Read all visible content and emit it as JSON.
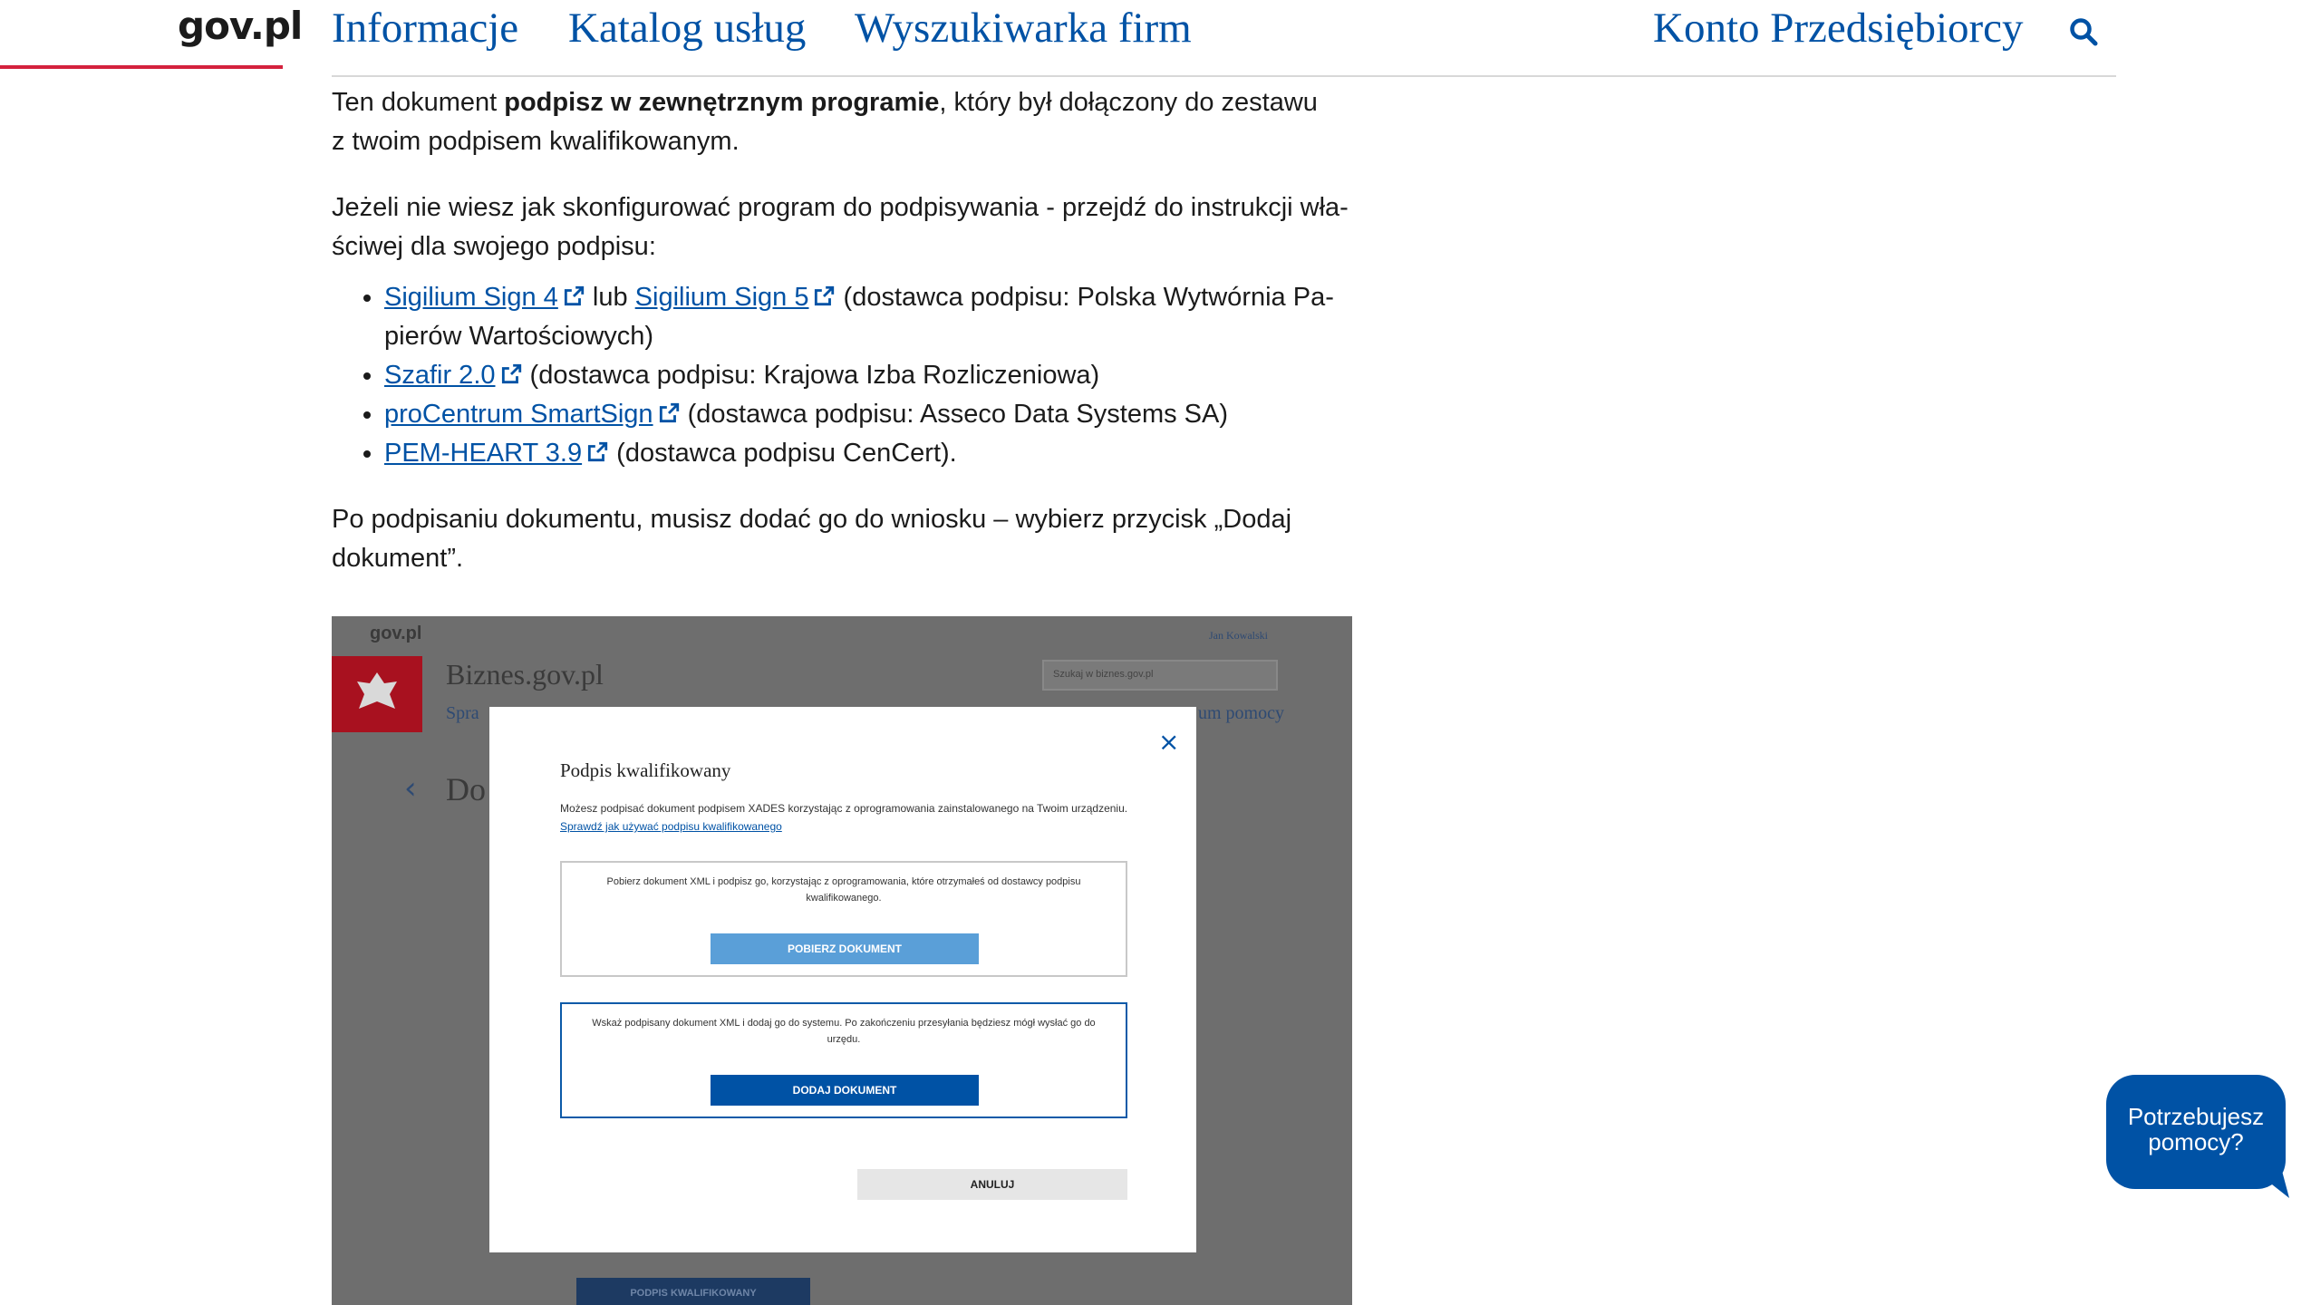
{
  "header": {
    "logo": "gov.pl",
    "nav": [
      "Informacje",
      "Katalog usług",
      "Wyszukiwarka firm"
    ],
    "account": "Konto Przedsiębiorcy",
    "search_icon": "search-icon"
  },
  "content": {
    "p1_a": "Ten dokument ",
    "p1_b": "podpisz w zewnętrznym programie",
    "p1_c": ", który był dołączony do zestawu",
    "p1_d": "z twoim podpisem kwalifikowanym.",
    "p2_a": "Jeżeli nie wiesz jak skonfigurować program do podpisywania - przejdź do instrukcji wła-",
    "p2_b": "ściwej dla swojego podpisu:",
    "list": {
      "i1_link1": "Sigilium Sign 4",
      "i1_mid": " lub ",
      "i1_link2": "Sigilium Sign 5",
      "i1_rest_a": " (dostawca podpisu: Polska Wytwórnia Pa-",
      "i1_rest_b": "pierów Wartościowych)",
      "i2_link": "Szafir 2.0",
      "i2_rest": " (dostawca podpisu: Krajowa Izba Rozliczeniowa)",
      "i3_link": "proCentrum SmartSign",
      "i3_rest": " (dostawca podpisu: Asseco Data Systems SA)",
      "i4_link": "PEM-HEART 3.9",
      "i4_rest": " (dostawca podpisu CenCert)."
    },
    "p3_a": "Po podpisaniu dokumentu, musisz dodać go do wniosku – wybierz przycisk „Dodaj",
    "p3_b": "dokument”."
  },
  "screenshot": {
    "bg_logo": "gov.pl",
    "bg_title": "Biznes.gov.pl",
    "bg_doc": "Do",
    "bg_user": "Jan Kowalski",
    "bg_search_placeholder": "Szukaj w biznes.gov.pl",
    "bg_help": "um pomocy",
    "bg_spr": "Spra",
    "bg_bottom_button": "PODPIS KWALIFIKOWANY",
    "modal": {
      "title": "Podpis kwalifikowany",
      "close": "×",
      "desc": "Możesz podpisać dokument podpisem XADES korzystając z oprogramowania zainstalowanego na Twoim urządzeniu.",
      "desc_link": "Sprawdź jak używać podpisu kwalifikowanego",
      "box1_text": "Pobierz dokument XML i podpisz go, korzystając z oprogramowania, które otrzymałeś od dostawcy podpisu kwalifikowanego.",
      "box1_button": "POBIERZ DOKUMENT",
      "box2_text": "Wskaż podpisany dokument XML i dodaj go do systemu. Po zakończeniu przesyłania będziesz mógł wysłać go do urzędu.",
      "box2_button": "DODAJ DOKUMENT",
      "cancel": "ANULUJ"
    }
  },
  "help_bubble": {
    "line1": "Potrzebujesz",
    "line2": "pomocy?"
  },
  "colors": {
    "brand_blue": "#0052a5",
    "accent_red": "#d4213d"
  }
}
